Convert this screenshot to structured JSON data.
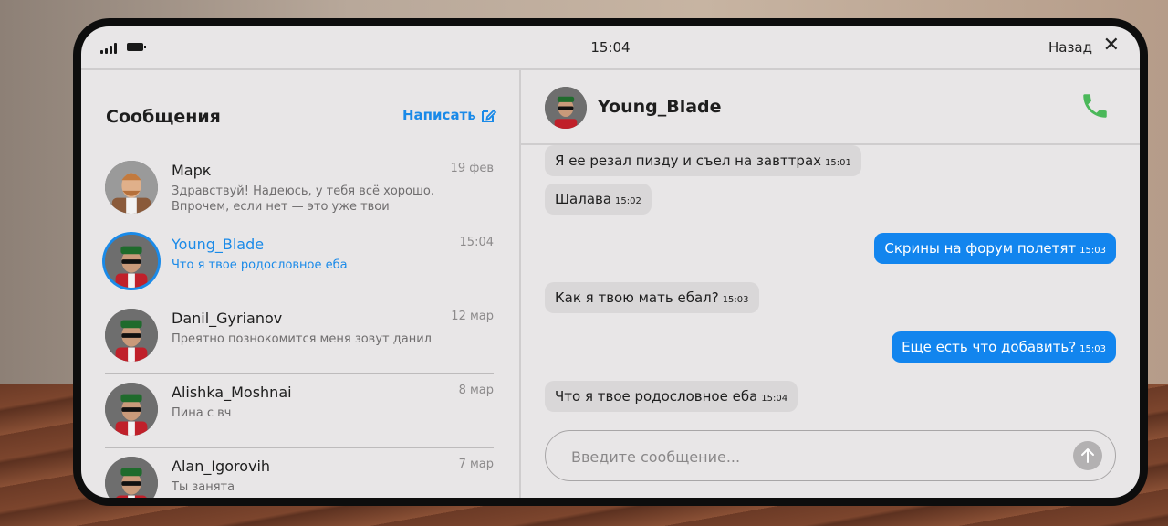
{
  "status": {
    "time": "15:04",
    "back_label": "Назад",
    "close_glyph": "✕"
  },
  "left": {
    "title": "Сообщения",
    "compose_label": "Написать",
    "conversations": [
      {
        "name": "Марк",
        "date": "19 фев",
        "preview": "Здравствуй! Надеюсь, у тебя всё хорошо. Впрочем, если нет — это уже твои",
        "active": false
      },
      {
        "name": "Young_Blade",
        "date": "15:04",
        "preview": "Что я твое родословное еба",
        "active": true
      },
      {
        "name": "Danil_Gyrianov",
        "date": "12 мар",
        "preview": "Преятно познокомится меня зовут данил",
        "active": false
      },
      {
        "name": "Alishka_Moshnai",
        "date": "8 мар",
        "preview": "Пина с вч",
        "active": false
      },
      {
        "name": "Alan_Igorovih",
        "date": "7 мар",
        "preview": "Ты занята",
        "active": false
      }
    ]
  },
  "chat": {
    "contact_name": "Young_Blade",
    "messages": [
      {
        "dir": "in",
        "text": "Я ее резал пизду и съел на завттрах",
        "time": "15:01"
      },
      {
        "dir": "in",
        "text": "Шалава",
        "time": "15:02"
      },
      {
        "dir": "out",
        "text": "Скрины на форум полетят",
        "time": "15:03"
      },
      {
        "dir": "in",
        "text": "Как я твою мать ебал?",
        "time": "15:03"
      },
      {
        "dir": "out",
        "text": "Еще есть что добавить?",
        "time": "15:03"
      },
      {
        "dir": "in",
        "text": "Что я твое родословное еба",
        "time": "15:04"
      }
    ],
    "input_placeholder": "Введите сообщение..."
  },
  "icons": {
    "signal": "signal-icon",
    "battery": "battery-icon",
    "close": "close-icon",
    "compose": "compose-icon",
    "call": "phone-icon",
    "send": "send-arrow-icon"
  },
  "colors": {
    "accent": "#1a8ae8",
    "outgoing_bubble": "#1285ee",
    "incoming_bubble": "#d9d7d8",
    "call_green": "#4bb85a"
  }
}
